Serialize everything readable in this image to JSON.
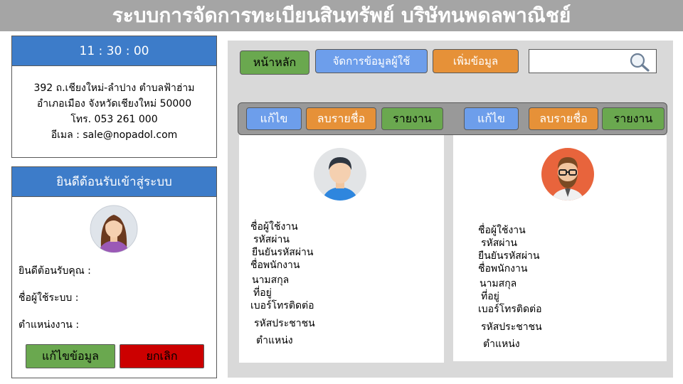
{
  "header": {
    "title": "ระบบการจัดการทะเบียนสินทรัพย์ บริษัทนพดลพาณิชย์"
  },
  "info_panel": {
    "time": "11 : 30 : 00",
    "address_line1": "392 ถ.เชียงใหม่-ลำปาง ตำบลฟ้าฮ่าม",
    "address_line2": "อำเภอเมือง จังหวัดเชียงใหม่ 50000",
    "phone": "โทร. 053 261 000",
    "email": "อีเมล : sale@nopadol.com"
  },
  "welcome_panel": {
    "title": "ยินดีต้อนรับเข้าสู่ระบบ",
    "welcome_label": "ยินดีต้อนรับคุณ :",
    "username_label": "ชื่อผู้ใช้ระบบ :",
    "position_label": "ตำแหน่งงาน :",
    "edit_button": "แก้ไขข้อมูล",
    "cancel_button": "ยกเลิก"
  },
  "nav": {
    "home": "หน้าหลัก",
    "manage_users": "จัดการข้อมูลผู้ใช้",
    "add_data": "เพิ่มข้อมูล",
    "search_value": "",
    "search_icon": "magnifier-icon"
  },
  "cards": [
    {
      "actions": {
        "edit": "แก้ไข",
        "delete": "ลบรายชื่อ",
        "report": "รายงาน"
      },
      "fields": [
        "ชื่อผู้ใช้งาน",
        "รหัสผ่าน",
        "ยืนยันรหัสผ่าน",
        "ชื่อพนักงาน",
        "นามสกุล",
        "ที่อยู่",
        "เบอร์โทรติดต่อ",
        "รหัสประชาชน",
        "ตำแหน่ง"
      ]
    },
    {
      "actions": {
        "edit": "แก้ไข",
        "delete": "ลบรายชื่อ",
        "report": "รายงาน"
      },
      "fields": [
        "ชื่อผู้ใช้งาน",
        "รหัสผ่าน",
        "ยืนยันรหัสผ่าน",
        "ชื่อพนักงาน",
        "นามสกุล",
        "ที่อยู่",
        "เบอร์โทรติดต่อ",
        "รหัสประชาชน",
        "ตำแหน่ง"
      ]
    }
  ],
  "colors": {
    "header_gray": "#a5a5a5",
    "panel_blue": "#3d7cc9",
    "button_green": "#6aa84f",
    "button_red": "#cc0000",
    "button_blue": "#6d9eeb",
    "button_orange": "#e69138"
  }
}
